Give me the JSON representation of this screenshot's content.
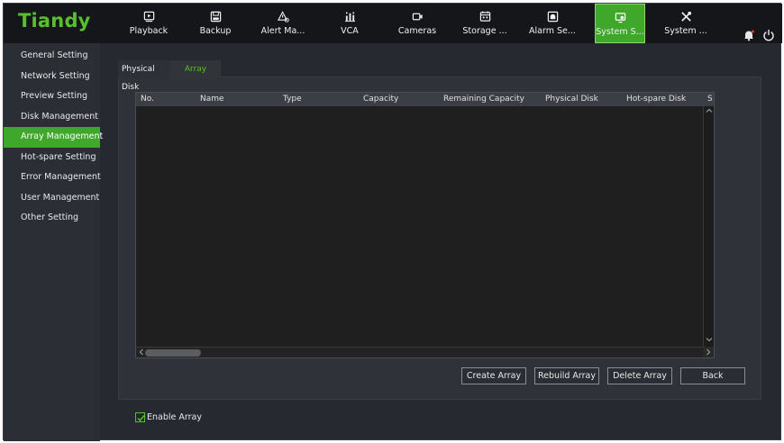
{
  "brand": {
    "logo": "Tiandy",
    "accent": "#3fa82a"
  },
  "nav": {
    "items": [
      {
        "label": "Playback",
        "icon": "playback-icon"
      },
      {
        "label": "Backup",
        "icon": "backup-icon"
      },
      {
        "label": "Alert Ma...",
        "icon": "alert-icon"
      },
      {
        "label": "VCA",
        "icon": "vca-icon"
      },
      {
        "label": "Cameras",
        "icon": "camera-icon"
      },
      {
        "label": "Storage ...",
        "icon": "storage-icon"
      },
      {
        "label": "Alarm Se...",
        "icon": "alarm-icon"
      },
      {
        "label": "System S...",
        "icon": "system-settings-icon",
        "active": true
      },
      {
        "label": "System ...",
        "icon": "tools-icon"
      }
    ]
  },
  "sidebar": {
    "items": [
      {
        "label": "General Setting"
      },
      {
        "label": "Network Setting"
      },
      {
        "label": "Preview Setting"
      },
      {
        "label": "Disk Management"
      },
      {
        "label": "Array Management",
        "active": true
      },
      {
        "label": "Hot-spare Setting"
      },
      {
        "label": "Error Management"
      },
      {
        "label": "User Management"
      },
      {
        "label": "Other Setting"
      }
    ]
  },
  "tabs": [
    {
      "label": "Physical Disk"
    },
    {
      "label": "Array",
      "active": true
    }
  ],
  "table": {
    "columns": [
      "No.",
      "Name",
      "Type",
      "Capacity",
      "Remaining Capacity",
      "Physical Disk",
      "Hot-spare Disk",
      "S"
    ],
    "rows": []
  },
  "buttons": {
    "create": "Create Array",
    "rebuild": "Rebuild Array",
    "delete": "Delete Array",
    "back": "Back"
  },
  "enable_array": {
    "label": "Enable Array",
    "checked": true
  }
}
